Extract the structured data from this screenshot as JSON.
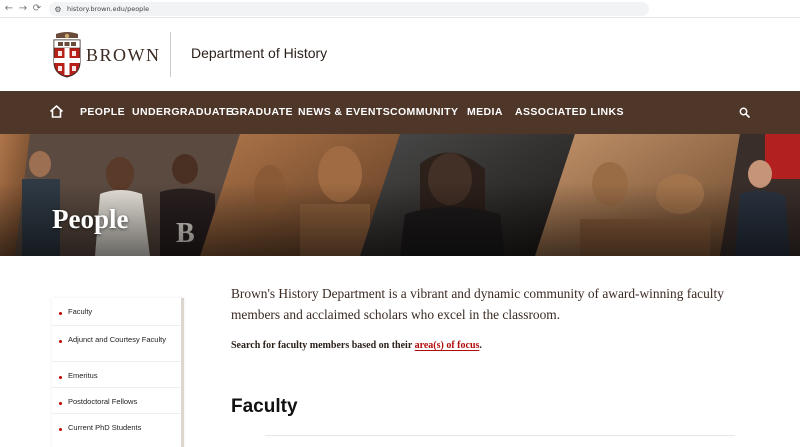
{
  "browser": {
    "back_glyph": "←",
    "forward_glyph": "→",
    "reload_glyph": "⟳",
    "site_info_glyph": "⚙",
    "url": "history.brown.edu/people"
  },
  "header": {
    "wordmark": "BROWN",
    "department": "Department of History",
    "logo_icon": "brown-shield-icon"
  },
  "nav": {
    "home_icon": "home-icon",
    "items": [
      "PEOPLE",
      "UNDERGRADUATE",
      "GRADUATE",
      "NEWS & EVENTS",
      "COMMUNITY",
      "MEDIA",
      "ASSOCIATED LINKS"
    ],
    "search_icon": "search-icon",
    "background": "#4e3629"
  },
  "hero": {
    "title": "People"
  },
  "sidebar": {
    "items": [
      "Faculty",
      "Adjunct and Courtesy Faculty",
      "Emeritus",
      "Postdoctoral Fellows",
      "Current PhD Students"
    ]
  },
  "main": {
    "intro": "Brown's History Department is a vibrant and dynamic community of award-winning faculty members and acclaimed scholars who excel in the classroom.",
    "search_prefix": "Search for faculty members based on their ",
    "search_link": "area(s) of focus",
    "search_suffix": ".",
    "section_heading": "Faculty"
  },
  "colors": {
    "brand_brown": "#4e3629",
    "accent_red": "#c00404",
    "link_red": "#b30c0c"
  }
}
